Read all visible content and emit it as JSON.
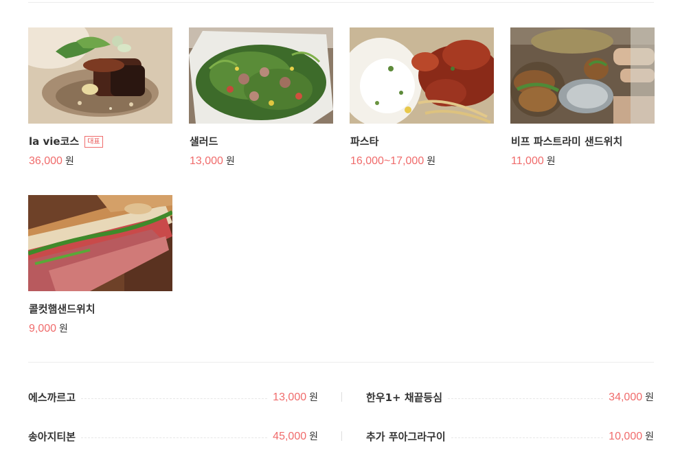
{
  "menu": {
    "items": [
      {
        "name": "la vie코스",
        "badge": "대표",
        "price": "36,000",
        "unit": "원"
      },
      {
        "name": "샐러드",
        "price": "13,000",
        "unit": "원"
      },
      {
        "name": "파스타",
        "price": "16,000~17,000",
        "unit": "원"
      },
      {
        "name": "비프 파스트라미 샌드위치",
        "price": "11,000",
        "unit": "원"
      },
      {
        "name": "콜컷햄샌드위치",
        "price": "9,000",
        "unit": "원"
      }
    ]
  },
  "extras": {
    "items": [
      {
        "name": "에스까르고",
        "price": "13,000",
        "unit": "원"
      },
      {
        "name": "한우1+ 채끝등심",
        "price": "34,000",
        "unit": "원"
      },
      {
        "name": "송아지티본",
        "price": "45,000",
        "unit": "원"
      },
      {
        "name": "추가 푸아그라구이",
        "price": "10,000",
        "unit": "원"
      }
    ]
  },
  "colors": {
    "price": "#f06b6b",
    "text": "#333333",
    "divider": "#ececec",
    "badge_border": "#f06b6b"
  }
}
